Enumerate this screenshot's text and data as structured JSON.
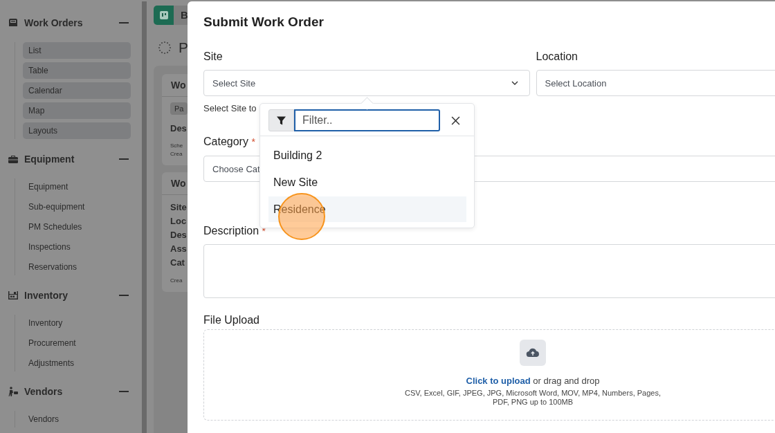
{
  "sidebar": {
    "sections": [
      {
        "title": "Work Orders",
        "expanded": true,
        "kind": "pills",
        "items": [
          "List",
          "Table",
          "Calendar",
          "Map",
          "Layouts"
        ]
      },
      {
        "title": "Equipment",
        "expanded": true,
        "kind": "links",
        "items": [
          "Equipment",
          "Sub-equipment",
          "PM Schedules",
          "Inspections",
          "Reservations"
        ]
      },
      {
        "title": "Inventory",
        "expanded": true,
        "kind": "links",
        "items": [
          "Inventory",
          "Procurement",
          "Adjustments"
        ]
      },
      {
        "title": "Vendors",
        "expanded": true,
        "kind": "links",
        "items": [
          "Vendors"
        ]
      }
    ]
  },
  "background": {
    "header_button": "B",
    "page_title": "P",
    "cards": [
      {
        "title": "Wo",
        "rows": [
          {
            "kind": "badge",
            "text": "Pa"
          },
          {
            "kind": "heading",
            "text": "Des"
          },
          {
            "kind": "small",
            "text": "Sche"
          },
          {
            "kind": "small",
            "text": "Crea"
          }
        ]
      },
      {
        "title": "Wo",
        "rows": [
          {
            "kind": "field",
            "text": "Site"
          },
          {
            "kind": "field",
            "text": "Loc"
          },
          {
            "kind": "field",
            "text": "Des"
          },
          {
            "kind": "field",
            "text": "Ass"
          },
          {
            "kind": "field",
            "text": "Cat"
          },
          {
            "kind": "small",
            "text": "Crea"
          }
        ]
      }
    ]
  },
  "dialog": {
    "title": "Submit Work Order",
    "site": {
      "label": "Site",
      "placeholder": "Select Site",
      "help": "Select Site to"
    },
    "location": {
      "label": "Location",
      "placeholder": "Select Location"
    },
    "category": {
      "label": "Category",
      "required_mark": "*",
      "placeholder": "Choose Cat"
    },
    "description": {
      "label": "Description",
      "required_mark": "*"
    },
    "file_upload": {
      "label": "File Upload",
      "link": "Click to upload",
      "text": "or drag and drop",
      "hint": "CSV, Excel, GIF, JPEG, JPG, Microsoft Word, MOV, MP4, Numbers, Pages, PDF, PNG up to 100MB"
    },
    "site_dropdown": {
      "filter_placeholder": "Filter..",
      "options": [
        {
          "label": "Building 2",
          "selected": false
        },
        {
          "label": "New Site",
          "selected": false
        },
        {
          "label": "Residence",
          "selected": true
        }
      ]
    }
  }
}
